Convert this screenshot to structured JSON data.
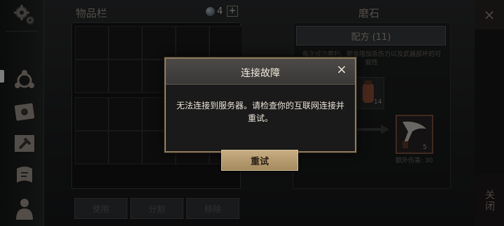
{
  "inventory": {
    "title": "物品栏",
    "gem_count": "4",
    "plus_label": "+",
    "buttons": [
      "使用",
      "分割",
      "移除"
    ]
  },
  "grindstone": {
    "title": "磨石",
    "recipe_label": "配方 (11)",
    "description": "每次成功磨利，都会增加杀伤力以及武器部坏的可能性",
    "item_a_count": "14",
    "item_b_count": "5",
    "extra_damage": "额外伤害: 30"
  },
  "right_rail": {
    "close_label": "关闭",
    "close_icon": "×"
  },
  "dialog": {
    "title": "连接故障",
    "close_icon": "×",
    "message": "无法连接到服务器。请检查你的互联网连接并重试。",
    "retry_label": "重试"
  },
  "colors": {
    "dialog_border": "#8c7a5c",
    "retry_button": "#c7ad81",
    "accent_rust": "#7a5140"
  }
}
